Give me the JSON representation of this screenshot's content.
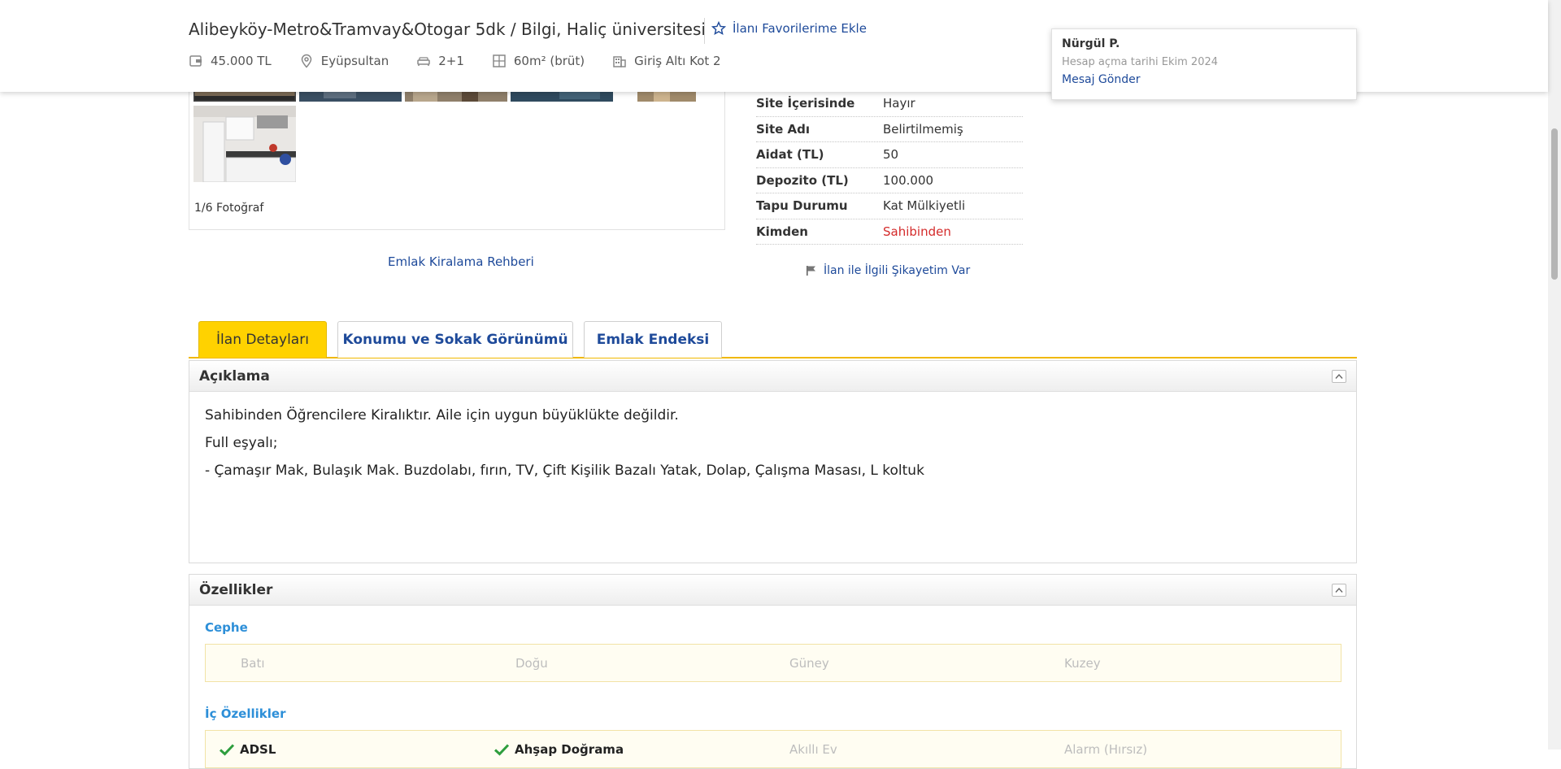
{
  "header": {
    "title": "Alibeyköy-Metro&Tramvay&Otogar 5dk / Bilgi, Haliç üniversitesi",
    "favorite_label": "İlanı Favorilerime Ekle",
    "meta": [
      {
        "icon": "wallet-icon",
        "text": "45.000 TL"
      },
      {
        "icon": "location-pin-icon",
        "text": "Eyüpsultan"
      },
      {
        "icon": "bed-icon",
        "text": "2+1"
      },
      {
        "icon": "floorplan-icon",
        "text": "60m² (brüt)"
      },
      {
        "icon": "building-icon",
        "text": "Giriş Altı Kot 2"
      }
    ]
  },
  "seller": {
    "name": "Nürgül P.",
    "account_date": "Hesap açma tarihi  Ekim 2024",
    "message_label": "Mesaj Gönder"
  },
  "gallery": {
    "photo_count": "1/6 Fotoğraf",
    "guide_link": "Emlak Kiralama Rehberi"
  },
  "details": [
    {
      "key": "Site İçerisinde",
      "value": "Hayır"
    },
    {
      "key": "Site Adı",
      "value": "Belirtilmemiş"
    },
    {
      "key": "Aidat (TL)",
      "value": "50"
    },
    {
      "key": "Depozito (TL)",
      "value": "100.000"
    },
    {
      "key": "Tapu Durumu",
      "value": "Kat Mülkiyetli"
    },
    {
      "key": "Kimden",
      "value": "Sahibinden"
    }
  ],
  "complaint_label": "İlan ile İlgili Şikayetim Var",
  "tabs": [
    {
      "label": "İlan Detayları",
      "active": true
    },
    {
      "label": "Konumu ve Sokak Görünümü",
      "active": false
    },
    {
      "label": "Emlak Endeksi",
      "active": false
    }
  ],
  "description": {
    "title": "Açıklama",
    "lines": [
      "Sahibinden Öğrencilere Kiralıktır. Aile için uygun büyüklükte değildir.",
      "Full eşyalı;",
      "- Çamaşır Mak, Bulaşık Mak. Buzdolabı, fırın, TV, Çift Kişilik Bazalı Yatak, Dolap, Çalışma Masası, L koltuk"
    ]
  },
  "features": {
    "title": "Özellikler",
    "groups": [
      {
        "title": "Cephe",
        "items": [
          {
            "label": "Batı",
            "selected": false
          },
          {
            "label": "Doğu",
            "selected": false
          },
          {
            "label": "Güney",
            "selected": false
          },
          {
            "label": "Kuzey",
            "selected": false
          }
        ]
      },
      {
        "title": "İç Özellikler",
        "items": [
          {
            "label": "ADSL",
            "selected": true
          },
          {
            "label": "Ahşap Doğrama",
            "selected": true
          },
          {
            "label": "Akıllı Ev",
            "selected": false
          },
          {
            "label": "Alarm (Hırsız)",
            "selected": false
          }
        ]
      }
    ]
  },
  "colors": {
    "link": "#1e4a9a",
    "accent_yellow": "#ffd200",
    "seller_type_red": "#d42b2b",
    "feature_group_blue": "#2d8fd8",
    "check_green": "#2e9e3e"
  }
}
